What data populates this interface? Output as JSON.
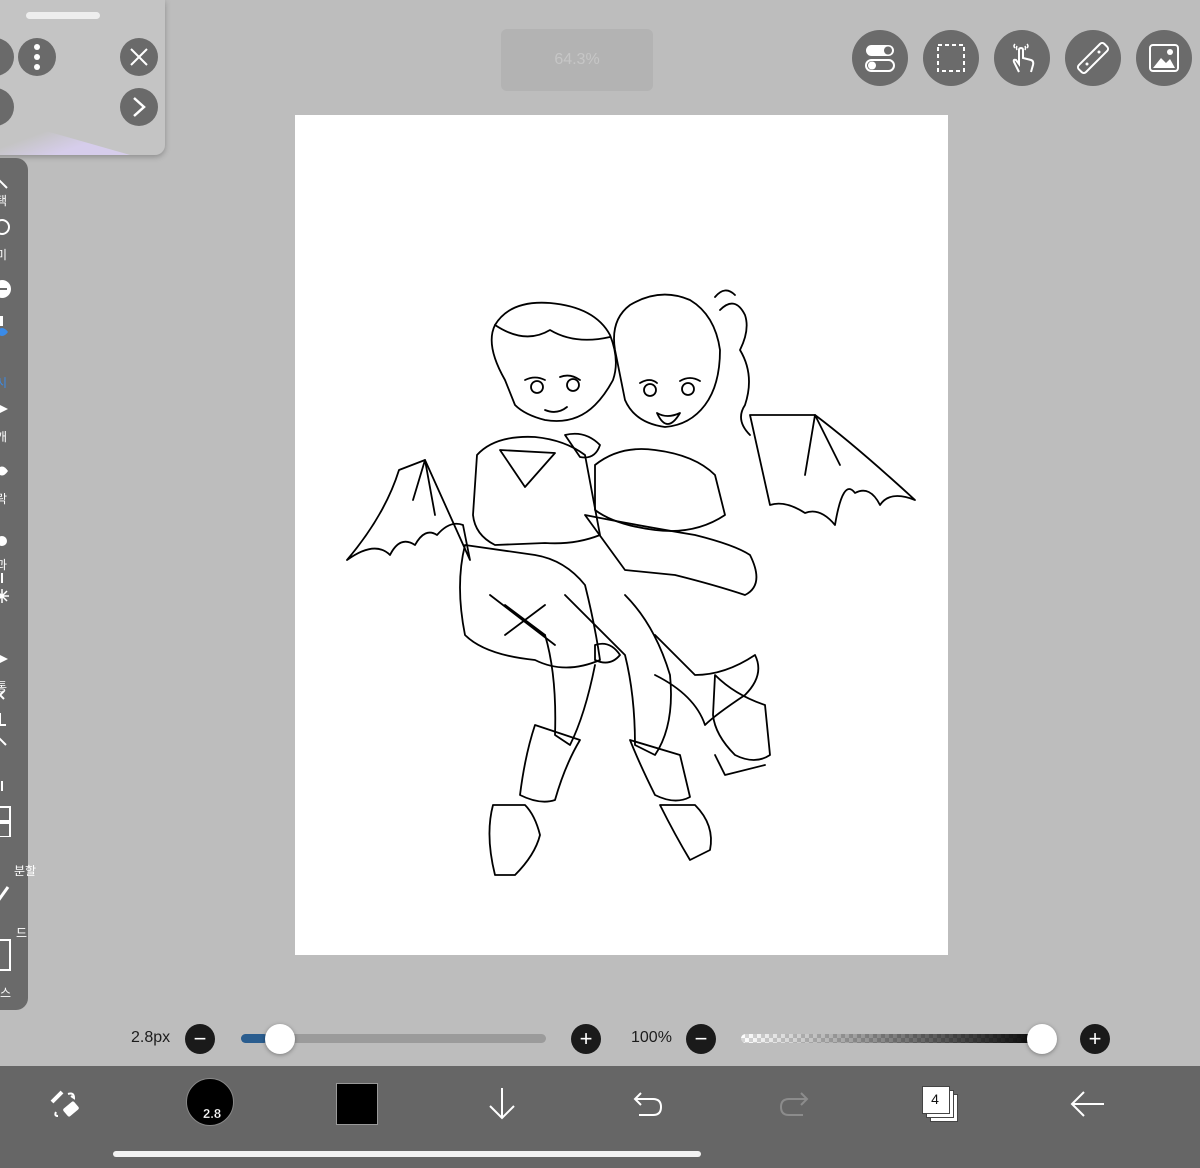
{
  "header": {
    "zoom": "64.3%",
    "buttons": [
      "toggle-icon",
      "selection-icon",
      "touch-gesture-icon",
      "ruler-icon",
      "image-icon"
    ]
  },
  "sidebar": {
    "items": [
      {
        "label": "택",
        "icon": "arrow-icon"
      },
      {
        "label": "미",
        "icon": "lasso-icon"
      },
      {
        "label": "",
        "icon": "magic-wand-icon"
      },
      {
        "label": "시",
        "icon": "brush-icon",
        "active": true
      },
      {
        "label": "개",
        "icon": "eraser-icon"
      },
      {
        "label": "락",
        "icon": "smudge-icon"
      },
      {
        "label": "과",
        "icon": "blur-icon"
      },
      {
        "label": "",
        "icon": "sparkle-icon"
      },
      {
        "label": "통",
        "icon": "fill-icon"
      },
      {
        "label": "",
        "icon": "text-icon"
      },
      {
        "label": "분할",
        "icon": "frame-divider-icon"
      },
      {
        "label": "드",
        "icon": "eyedropper-icon"
      },
      {
        "label": "스",
        "icon": "canvas-icon"
      }
    ],
    "accent_color": "#3a8be8"
  },
  "sliders": {
    "brush_size_label": "2.8px",
    "brush_size_fraction": 0.09,
    "opacity_label": "100%",
    "opacity_fraction": 1.0,
    "minus": "−",
    "plus": "+"
  },
  "bottom_bar": {
    "brush_size_badge": "2.8",
    "layer_count": "4",
    "current_color": "#000000"
  }
}
